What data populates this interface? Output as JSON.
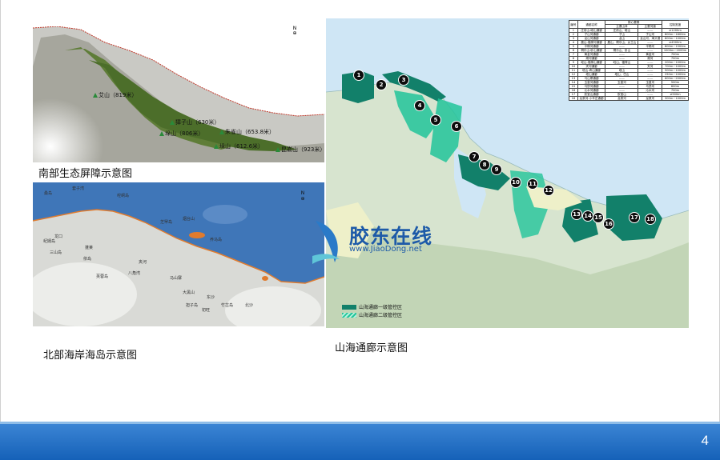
{
  "captions": {
    "south_barrier": "南部生态屏障示意图",
    "north_coast": "北部海岸海岛示意图",
    "corridor": "山海通廊示意图"
  },
  "south_peaks": [
    {
      "label": "艾山（819米）"
    },
    {
      "label": "獐子山（630米）"
    },
    {
      "label": "垛山（806米）"
    },
    {
      "label": "朱雀山（653.8米）"
    },
    {
      "label": "垛山（612.6米）"
    },
    {
      "label": "昆嵛山（923米）"
    }
  ],
  "north_islands": [
    "套子湾",
    "崆峒岛",
    "芝罘岛",
    "烟台山",
    "养马岛",
    "夹河",
    "八角湾",
    "蓬莱",
    "龙口",
    "三山岛",
    "屺姆岛",
    "桑岛",
    "依岛",
    "芙蓉岛",
    "大黑山",
    "担子岛",
    "初旺",
    "竹岔岛",
    "东沙",
    "北沙",
    "马山寨"
  ],
  "corridor_markers": [
    "1",
    "2",
    "3",
    "4",
    "5",
    "6",
    "7",
    "8",
    "9",
    "10",
    "11",
    "12",
    "13",
    "14",
    "15",
    "16",
    "17",
    "18"
  ],
  "legend": {
    "level1": "山海通廊一级管控区",
    "level2": "山海通廊二级管控区"
  },
  "table": {
    "headers": [
      "编号",
      "通廊名称",
      "主要山体",
      "主要河道",
      "控制宽度"
    ],
    "group_header": "核心要素",
    "rows": [
      [
        "1",
        "庄前山-磁山通廊",
        "庄前山、磁山",
        "——",
        "≥1200m"
      ],
      [
        "2",
        "子山河通廊",
        "子山",
        "子山河",
        "800m~1600m"
      ],
      [
        "3",
        "龙山河通廊",
        "龙山",
        "龙山河、海头港",
        "800m~1000m"
      ],
      [
        "4",
        "鹿山-福禄河通廊",
        "鹿山、桐乐山、女王山",
        "——",
        "≥4500m"
      ],
      [
        "5",
        "平畅河通廊",
        "——",
        "平畅河",
        "800m~1500m"
      ],
      [
        "6",
        "桐乐山-卧山通廊",
        "桐乐山、卧山",
        "——",
        "1000m~2000m"
      ],
      [
        "7",
        "黄金河通廊",
        "——",
        "黄金河",
        "700m"
      ],
      [
        "8",
        "湘河通廊",
        "——",
        "湘河",
        "700m"
      ],
      [
        "9",
        "崆山-福禄山通廊",
        "崆山、福禄山",
        "——",
        "200m~1000m"
      ],
      [
        "10",
        "夹河通廊",
        "——",
        "夹河",
        "700m~1000m"
      ],
      [
        "11",
        "塔山-奇山通廊",
        "塔山",
        "——",
        "500m~1000m"
      ],
      [
        "12",
        "塔山通廊",
        "塔山、岱山",
        "——",
        "250m~1000m"
      ],
      [
        "13",
        "马山寨通廊",
        "——",
        "——",
        "600m~2000m"
      ],
      [
        "14",
        "玉皇河通廊",
        "玉皇河",
        "玉皇河",
        "500m"
      ],
      [
        "15",
        "马鬃河通廊",
        "——",
        "马鬃河",
        "600m"
      ],
      [
        "16",
        "沁水河通廊",
        "——",
        "沁水河",
        "700m"
      ],
      [
        "17",
        "胶宝山通廊",
        "胶宝山",
        "——",
        "≥500m"
      ],
      [
        "18",
        "龙泉河-小辛庄通廊",
        "龙泉河",
        "龙泉河",
        "300m~1000m"
      ]
    ]
  },
  "watermark": {
    "name": "胶东在线",
    "url": "www.JiaoDong.net"
  },
  "page_number": "4",
  "colors": {
    "footer": "#1561b8",
    "corridor_dark": "#12806a",
    "corridor_light": "#22c49a",
    "sea": "#cfe6f5",
    "north_sea": "#3f76b8"
  }
}
